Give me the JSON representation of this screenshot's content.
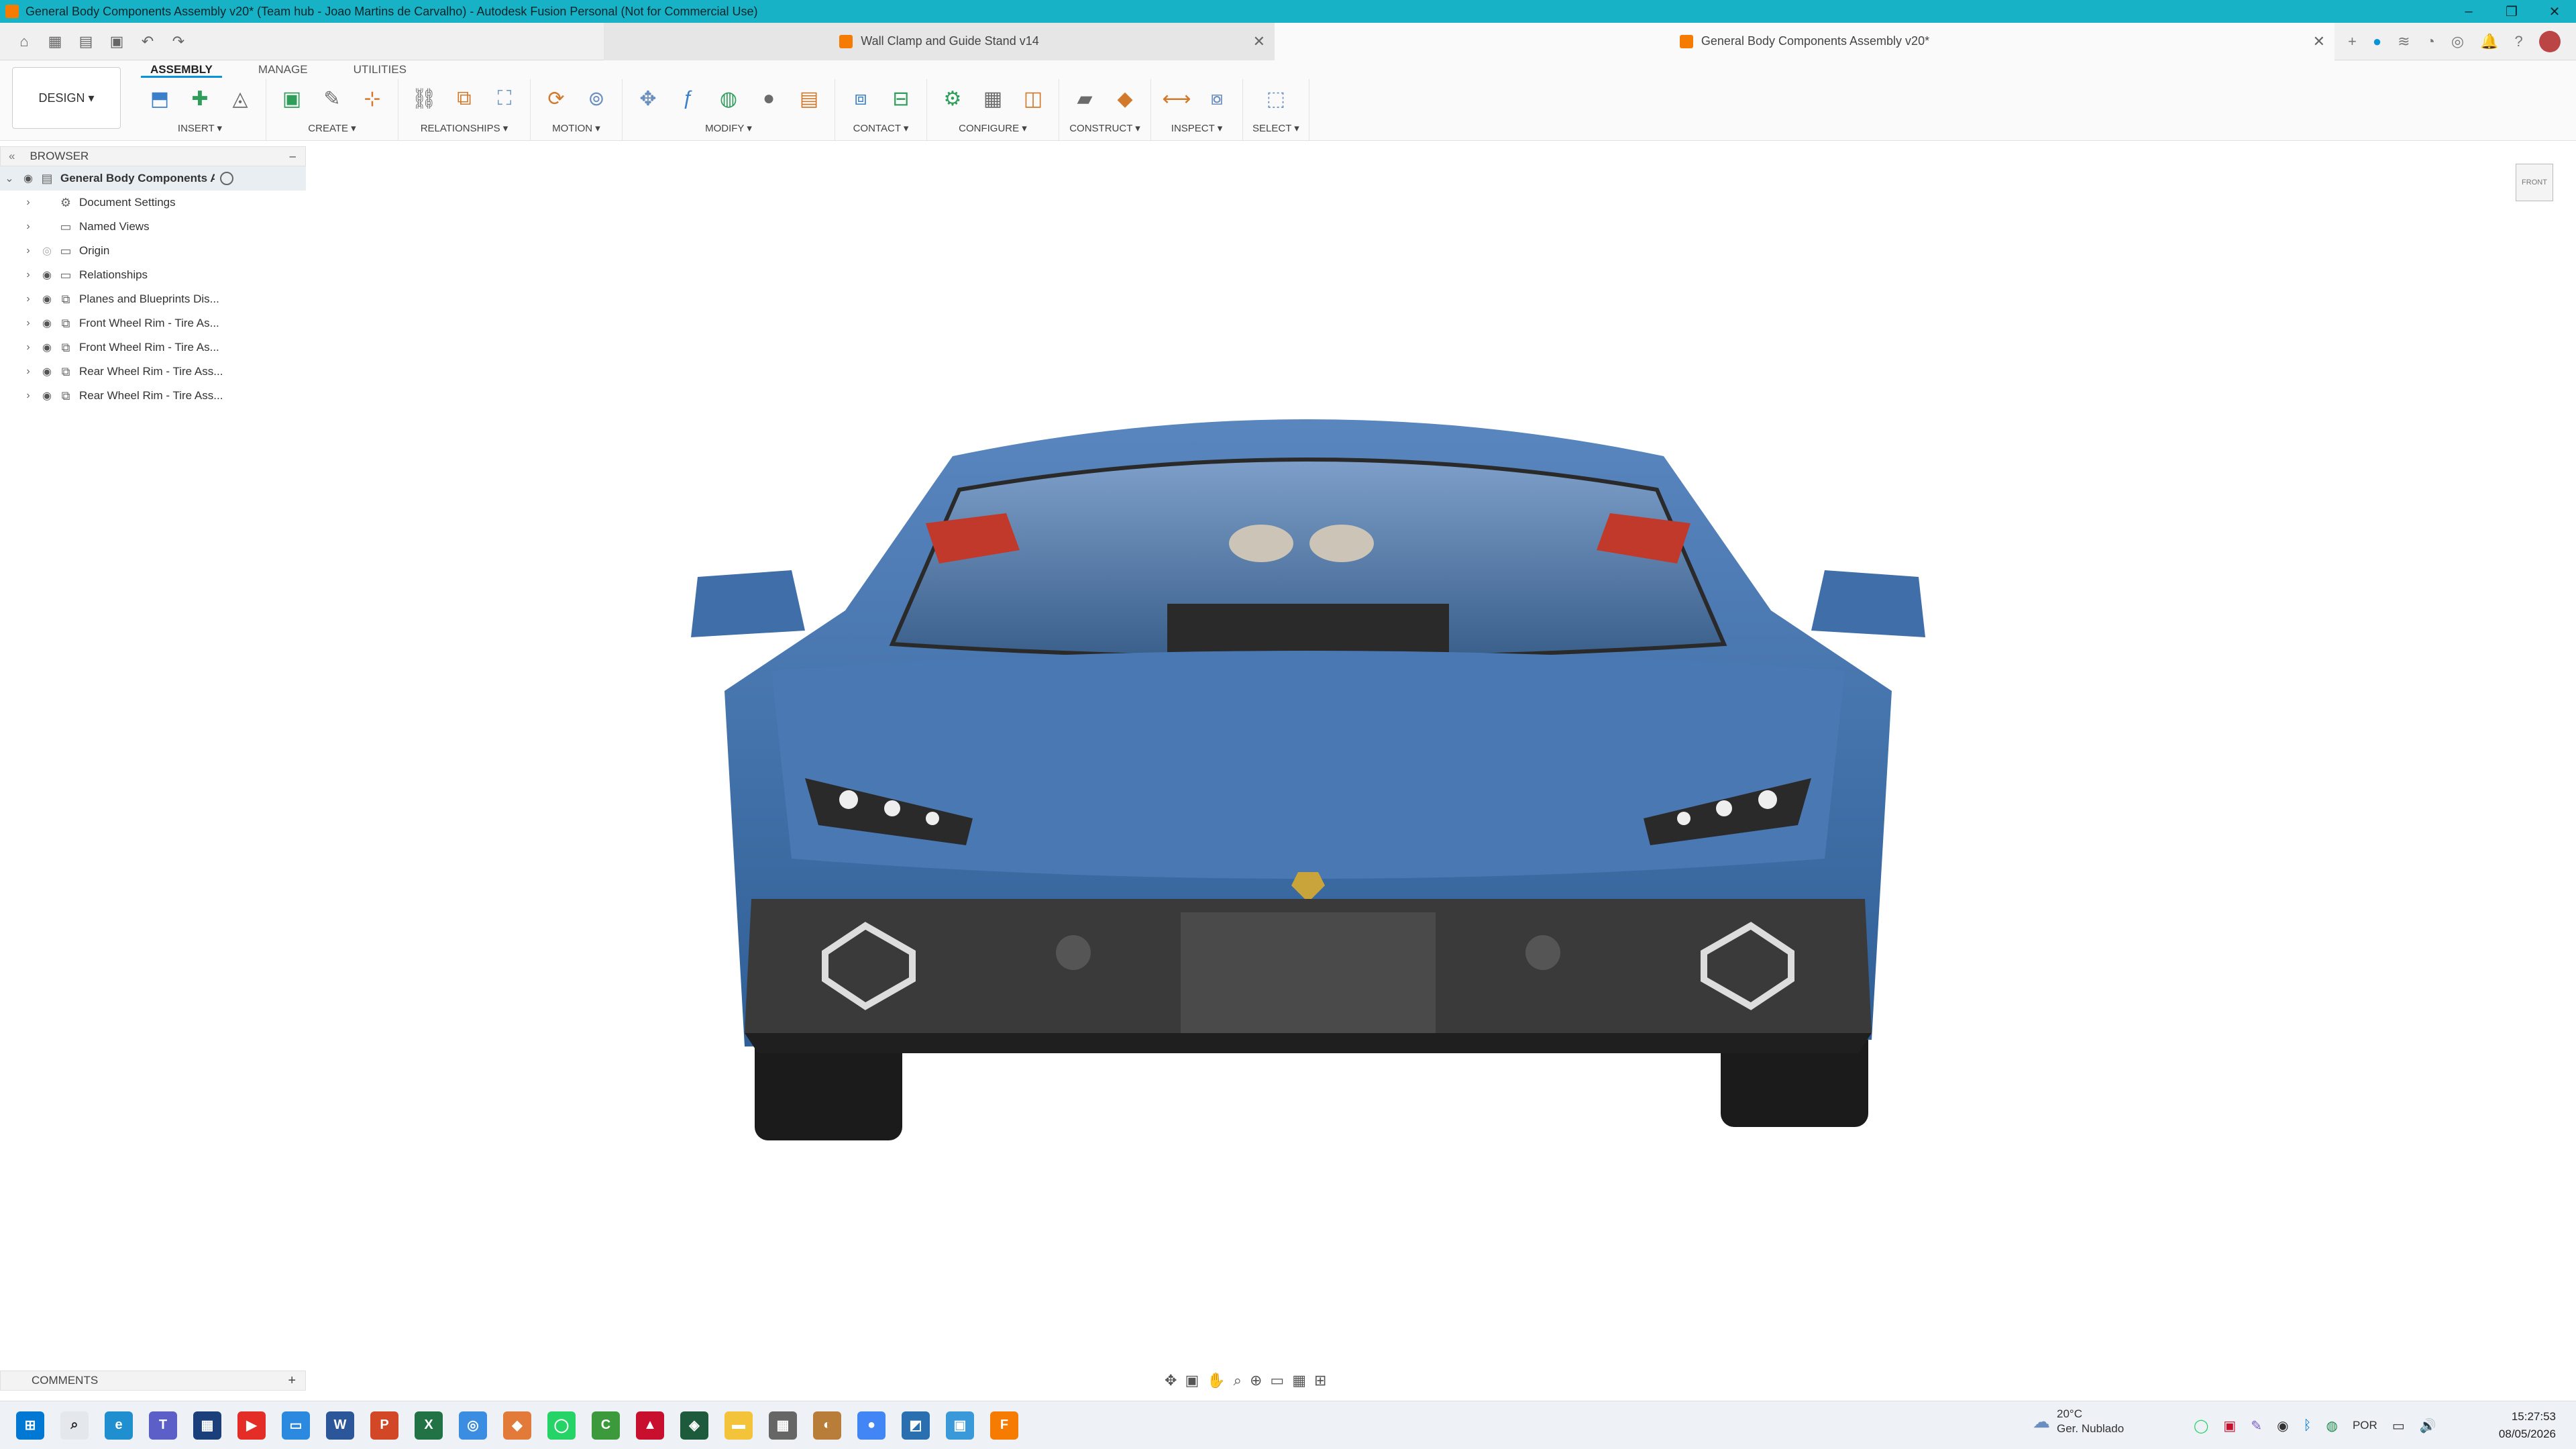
{
  "window": {
    "title": "General Body Components Assembly v20* (Team hub - Joao Martins de Carvalho) - Autodesk Fusion Personal (Not for Commercial Use)"
  },
  "tabs": [
    {
      "label": "Wall Clamp and Guide Stand v14",
      "active": false
    },
    {
      "label": "General Body Components Assembly v20*",
      "active": true
    }
  ],
  "workspace": {
    "label": "DESIGN ▾"
  },
  "ribbon_tabs": [
    "ASSEMBLY",
    "MANAGE",
    "UTILITIES"
  ],
  "toolbar_groups": [
    {
      "label": "INSERT ▾",
      "icons": [
        "insert-component-icon",
        "insert-new-icon",
        "insert-mesh-icon"
      ]
    },
    {
      "label": "CREATE ▾",
      "icons": [
        "new-component-icon",
        "create-sketch-icon",
        "create-joint-origin-icon"
      ]
    },
    {
      "label": "RELATIONSHIPS ▾",
      "icons": [
        "joint-icon",
        "as-built-joint-icon",
        "rigid-group-icon"
      ]
    },
    {
      "label": "MOTION ▾",
      "icons": [
        "drive-joints-icon",
        "motion-link-icon"
      ]
    },
    {
      "label": "MODIFY ▾",
      "icons": [
        "move-icon",
        "parameters-icon",
        "physical-material-icon",
        "appearance-icon",
        "compute-all-icon"
      ]
    },
    {
      "label": "CONTACT ▾",
      "icons": [
        "contact-sets-icon",
        "enable-contact-icon"
      ]
    },
    {
      "label": "CONFIGURE ▾",
      "icons": [
        "configure-icon",
        "config-table-icon",
        "config-rule-icon"
      ]
    },
    {
      "label": "CONSTRUCT ▾",
      "icons": [
        "offset-plane-icon",
        "axis-icon"
      ]
    },
    {
      "label": "INSPECT ▾",
      "icons": [
        "measure-icon",
        "interference-icon"
      ]
    },
    {
      "label": "SELECT ▾",
      "icons": [
        "select-box-icon"
      ]
    }
  ],
  "browser": {
    "title": "BROWSER",
    "root": "General Body Components A...",
    "items": [
      {
        "label": "Document Settings",
        "icon": "gear-icon",
        "eye": false
      },
      {
        "label": "Named Views",
        "icon": "folder-icon",
        "eye": false
      },
      {
        "label": "Origin",
        "icon": "folder-icon",
        "eye": "hidden"
      },
      {
        "label": "Relationships",
        "icon": "folder-icon",
        "eye": true
      },
      {
        "label": "Planes and Blueprints Dis...",
        "icon": "component-link-icon",
        "eye": true
      },
      {
        "label": "Front Wheel Rim - Tire As...",
        "icon": "component-link-icon",
        "eye": true
      },
      {
        "label": "Front Wheel Rim - Tire As...",
        "icon": "component-link-icon",
        "eye": true
      },
      {
        "label": "Rear Wheel Rim - Tire Ass...",
        "icon": "component-link-icon",
        "eye": true
      },
      {
        "label": "Rear Wheel Rim - Tire Ass...",
        "icon": "component-link-icon",
        "eye": true
      }
    ]
  },
  "viewcube": {
    "face": "FRONT"
  },
  "comments": {
    "label": "COMMENTS"
  },
  "taskbar": {
    "weather_temp": "20°C",
    "weather_desc": "Ger. Nublado",
    "lang": "POR",
    "time": "15:27:53",
    "date": "08/05/2026"
  },
  "colors": {
    "accent": "#0696d7",
    "titlebar": "#17b2c6",
    "car_body": "#3c6ea6"
  }
}
